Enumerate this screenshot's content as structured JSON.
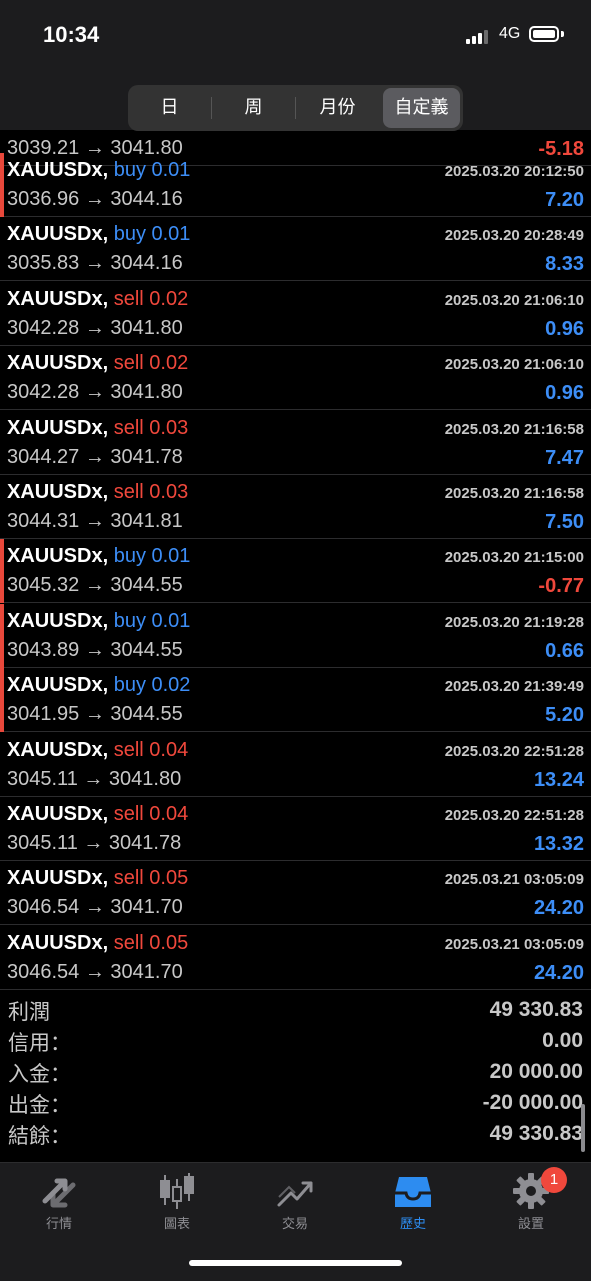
{
  "status_bar": {
    "time": "10:34",
    "network": "4G"
  },
  "segments": [
    {
      "label": "日"
    },
    {
      "label": "周"
    },
    {
      "label": "月份"
    },
    {
      "label": "自定義"
    }
  ],
  "partial_row": {
    "prices": "3039.21 → 3041.80",
    "pnl": "-5.18"
  },
  "trades": [
    {
      "symbol": "XAUUSDx,",
      "side": "buy 0.01",
      "dt": "2025.03.20 20:12:50",
      "prices": "3036.96 → 3044.16",
      "pnl": "7.20",
      "pnl_sign": "pos",
      "marked": true
    },
    {
      "symbol": "XAUUSDx,",
      "side": "buy 0.01",
      "dt": "2025.03.20 20:28:49",
      "prices": "3035.83 → 3044.16",
      "pnl": "8.33",
      "pnl_sign": "pos",
      "marked": false
    },
    {
      "symbol": "XAUUSDx,",
      "side": "sell 0.02",
      "dt": "2025.03.20 21:06:10",
      "prices": "3042.28 → 3041.80",
      "pnl": "0.96",
      "pnl_sign": "pos",
      "marked": false
    },
    {
      "symbol": "XAUUSDx,",
      "side": "sell 0.02",
      "dt": "2025.03.20 21:06:10",
      "prices": "3042.28 → 3041.80",
      "pnl": "0.96",
      "pnl_sign": "pos",
      "marked": false
    },
    {
      "symbol": "XAUUSDx,",
      "side": "sell 0.03",
      "dt": "2025.03.20 21:16:58",
      "prices": "3044.27 → 3041.78",
      "pnl": "7.47",
      "pnl_sign": "pos",
      "marked": false
    },
    {
      "symbol": "XAUUSDx,",
      "side": "sell 0.03",
      "dt": "2025.03.20 21:16:58",
      "prices": "3044.31 → 3041.81",
      "pnl": "7.50",
      "pnl_sign": "pos",
      "marked": false
    },
    {
      "symbol": "XAUUSDx,",
      "side": "buy 0.01",
      "dt": "2025.03.20 21:15:00",
      "prices": "3045.32 → 3044.55",
      "pnl": "-0.77",
      "pnl_sign": "neg",
      "marked": true
    },
    {
      "symbol": "XAUUSDx,",
      "side": "buy 0.01",
      "dt": "2025.03.20 21:19:28",
      "prices": "3043.89 → 3044.55",
      "pnl": "0.66",
      "pnl_sign": "pos",
      "marked": true
    },
    {
      "symbol": "XAUUSDx,",
      "side": "buy 0.02",
      "dt": "2025.03.20 21:39:49",
      "prices": "3041.95 → 3044.55",
      "pnl": "5.20",
      "pnl_sign": "pos",
      "marked": true
    },
    {
      "symbol": "XAUUSDx,",
      "side": "sell 0.04",
      "dt": "2025.03.20 22:51:28",
      "prices": "3045.11 → 3041.80",
      "pnl": "13.24",
      "pnl_sign": "pos",
      "marked": false
    },
    {
      "symbol": "XAUUSDx,",
      "side": "sell 0.04",
      "dt": "2025.03.20 22:51:28",
      "prices": "3045.11 → 3041.78",
      "pnl": "13.32",
      "pnl_sign": "pos",
      "marked": false
    },
    {
      "symbol": "XAUUSDx,",
      "side": "sell 0.05",
      "dt": "2025.03.21 03:05:09",
      "prices": "3046.54 → 3041.70",
      "pnl": "24.20",
      "pnl_sign": "pos",
      "marked": false
    },
    {
      "symbol": "XAUUSDx,",
      "side": "sell 0.05",
      "dt": "2025.03.21 03:05:09",
      "prices": "3046.54 → 3041.70",
      "pnl": "24.20",
      "pnl_sign": "pos",
      "marked": false
    }
  ],
  "summary": [
    {
      "label": "利潤",
      "value": "49 330.83"
    },
    {
      "label": "信用：",
      "value": "0.00"
    },
    {
      "label": "入金：",
      "value": "20 000.00"
    },
    {
      "label": "出金：",
      "value": "-20 000.00"
    },
    {
      "label": "結餘：",
      "value": "49 330.83"
    }
  ],
  "tabbar": [
    {
      "label": "行情",
      "icon": "quotes-arrows-icon"
    },
    {
      "label": "圖表",
      "icon": "candlestick-chart-icon"
    },
    {
      "label": "交易",
      "icon": "trade-chart-icon"
    },
    {
      "label": "歷史",
      "icon": "history-tray-icon"
    },
    {
      "label": "設置",
      "icon": "gear-icon"
    }
  ],
  "settings_badge": "1",
  "colors": {
    "buy": "#3d8ef7",
    "sell": "#f0483c",
    "profit": "#3d8ef7",
    "loss": "#f0483c",
    "active_tab": "#2d8cf0"
  }
}
